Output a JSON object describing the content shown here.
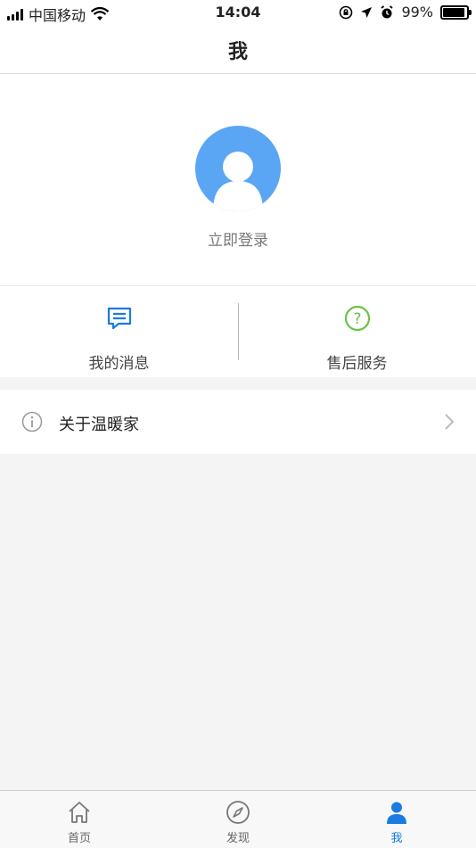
{
  "status_bar": {
    "carrier": "中国移动",
    "time": "14:04",
    "battery_percent": "99%",
    "battery_level": 0.99,
    "icons": [
      "signal-icon",
      "wifi-icon",
      "rotation-lock-icon",
      "location-icon",
      "alarm-icon",
      "battery-icon"
    ]
  },
  "nav": {
    "title": "我"
  },
  "profile": {
    "avatar_icon": "user-avatar-icon",
    "login_label": "立即登录"
  },
  "shortcuts": [
    {
      "label": "我的消息",
      "icon": "message-icon",
      "color": "#1a7be0"
    },
    {
      "label": "售后服务",
      "icon": "help-icon",
      "color": "#6cc24a"
    }
  ],
  "menu": [
    {
      "label": "关于温暖家",
      "icon": "info-icon"
    }
  ],
  "tabs": [
    {
      "label": "首页",
      "icon": "home-icon",
      "active": false
    },
    {
      "label": "发现",
      "icon": "compass-icon",
      "active": false
    },
    {
      "label": "我",
      "icon": "person-icon",
      "active": true
    }
  ],
  "colors": {
    "accent": "#1a7be0",
    "avatar_bg": "#5aa6f5",
    "help_green": "#6cc24a"
  }
}
